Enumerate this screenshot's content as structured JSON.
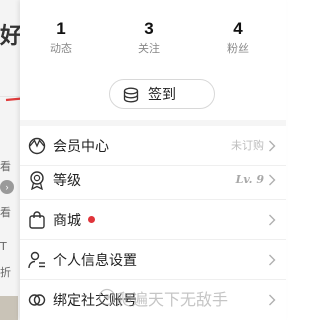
{
  "background": {
    "fragments": [
      "好",
      "看",
      "看",
      "T",
      "折"
    ],
    "badge": "›"
  },
  "stats": [
    {
      "count": "1",
      "label": "动态"
    },
    {
      "count": "3",
      "label": "关注"
    },
    {
      "count": "4",
      "label": "粉丝"
    }
  ],
  "checkin": {
    "label": "签到",
    "icon": "coin-stack-icon"
  },
  "menu": [
    {
      "label": "会员中心",
      "value": "未订购",
      "icon": "vip-icon"
    },
    {
      "label": "等级",
      "value": "Lv. 9",
      "icon": "level-badge-icon"
    },
    {
      "label": "商城",
      "value": "",
      "icon": "shopping-bag-icon",
      "has_dot": true
    },
    {
      "label": "个人信息设置",
      "value": "",
      "icon": "user-settings-icon"
    },
    {
      "label": "绑定社交账号",
      "value": "",
      "icon": "link-icon"
    }
  ],
  "watermark": {
    "text": "爬遍天下无敌手"
  },
  "colors": {
    "accent_dot": "#e0343a",
    "arrow": "#e03c3c"
  }
}
